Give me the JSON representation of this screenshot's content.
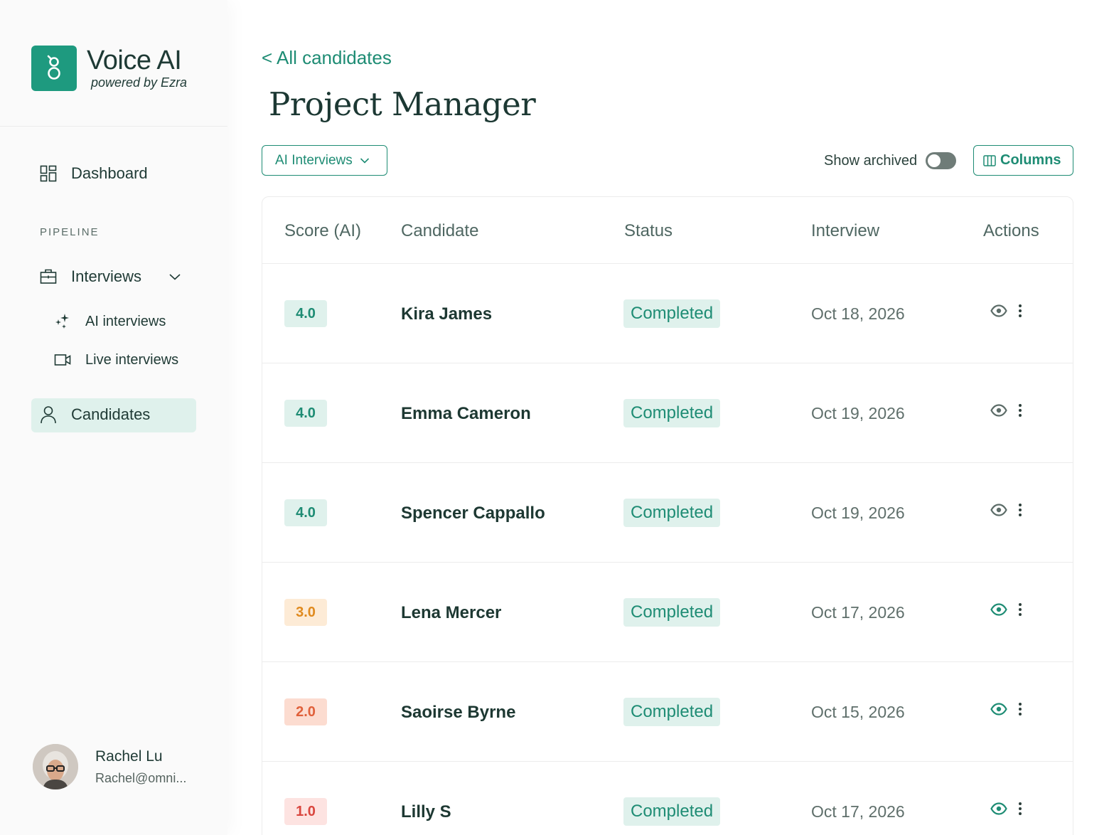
{
  "brand": {
    "title": "Voice AI",
    "subtitle": "powered by Ezra",
    "color": "#1e9a7f"
  },
  "sidebar": {
    "dashboard_label": "Dashboard",
    "section_label": "PIPELINE",
    "interviews_label": "Interviews",
    "ai_interviews_label": "AI interviews",
    "live_interviews_label": "Live interviews",
    "candidates_label": "Candidates"
  },
  "user": {
    "name": "Rachel Lu",
    "email": "Rachel@omni..."
  },
  "main": {
    "back_label": "< All candidates",
    "title": "Project Manager",
    "filter_label": "AI Interviews",
    "show_archived_label": "Show archived",
    "show_archived_on": false,
    "columns_label": "Columns"
  },
  "table": {
    "headers": [
      "Score (AI)",
      "Candidate",
      "Status",
      "Interview",
      "Actions"
    ],
    "rows": [
      {
        "score": "4.0",
        "name": "Kira James",
        "status": "Completed",
        "date": "Oct 18, 2026",
        "tier": "high"
      },
      {
        "score": "4.0",
        "name": "Emma Cameron",
        "status": "Completed",
        "date": "Oct 19, 2026",
        "tier": "high"
      },
      {
        "score": "4.0",
        "name": "Spencer Cappallo",
        "status": "Completed",
        "date": "Oct 19, 2026",
        "tier": "high"
      },
      {
        "score": "3.0",
        "name": "Lena Mercer",
        "status": "Completed",
        "date": "Oct 17, 2026",
        "tier": "mid"
      },
      {
        "score": "2.0",
        "name": "Saoirse Byrne",
        "status": "Completed",
        "date": "Oct 15, 2026",
        "tier": "low"
      },
      {
        "score": "1.0",
        "name": "Lilly S",
        "status": "Completed",
        "date": "Oct 17, 2026",
        "tier": "lowest"
      }
    ]
  },
  "colors": {
    "accent": "#1e8c74",
    "score_high_bg": "#dff1ec",
    "score_high_fg": "#1e8c74",
    "score_mid_bg": "#fdebd6",
    "score_mid_fg": "#e08a1e",
    "score_low_bg": "#fcdcd0",
    "score_low_fg": "#e0603a",
    "score_lowest_bg": "#fde3e1",
    "score_lowest_fg": "#d9463e"
  }
}
